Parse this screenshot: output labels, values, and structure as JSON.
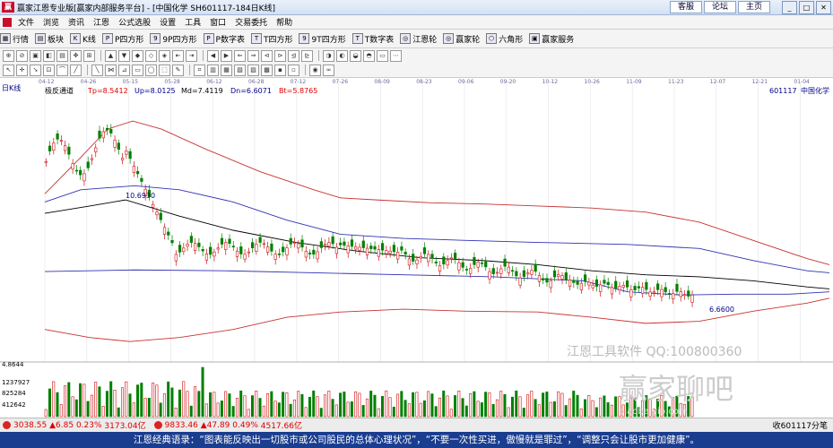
{
  "titlebar": {
    "title": "赢家江恩专业版[赢家内部服务平台] - [中国化学  SH601117-184日K线]",
    "links": [
      "客服",
      "论坛",
      "主页"
    ]
  },
  "menu": [
    "文件",
    "浏览",
    "资讯",
    "江恩",
    "公式选股",
    "设置",
    "工具",
    "窗口",
    "交易委托",
    "帮助"
  ],
  "toolbar": [
    "行情",
    "板块",
    "K线",
    "P四方形",
    "9P四方形",
    "P数字表",
    "T四方形",
    "9T四方形",
    "T数字表",
    "江恩轮",
    "赢家轮",
    "六角形",
    "赢家服务"
  ],
  "chart": {
    "period_label": "日K线",
    "indicator_name": "极反通道",
    "tp": "Tp=8.5412",
    "up": "Up=8.0125",
    "md": "Md=7.4119",
    "dn": "Dn=6.6071",
    "bt": "Bt=5.8765",
    "code": "601117",
    "name": "中国化学",
    "high_label": "10.6930",
    "low_label": "6.6600",
    "dates": [
      "04-12",
      "04-26",
      "05-15",
      "05-28",
      "06-12",
      "06-28",
      "07-12",
      "07-26",
      "08-09",
      "08-23",
      "09-06",
      "09-20",
      "10-12",
      "10-26",
      "11-09",
      "11-23",
      "12-07",
      "12-21",
      "01-04"
    ],
    "vol_labels": [
      "4.8644",
      "1237927",
      "825284",
      "412642"
    ],
    "watermark1": "江恩工具软件  QQ:100800360",
    "watermark2": "赢家聊吧",
    "watermark3": "piaoba.vip.com"
  },
  "chart_data": {
    "type": "candlestick",
    "period": "日K线",
    "high": 10.693,
    "low": 6.66,
    "tp": 8.5412,
    "up": 8.0125,
    "md": 7.4119,
    "dn": 6.6071,
    "bt": 5.8765,
    "x_labels": [
      "04-12",
      "04-26",
      "05-15",
      "05-28",
      "06-12",
      "06-28",
      "07-12",
      "07-26",
      "08-09",
      "08-23",
      "09-06",
      "09-20",
      "10-12",
      "10-26",
      "11-09",
      "11-23",
      "12-07",
      "12-21",
      "01-04"
    ],
    "volume_labels": [
      1237927,
      825284,
      412642
    ]
  },
  "statusbar": {
    "idx1_value": "3038.55",
    "idx1_change": "▲6.85",
    "idx1_pct": "0.23%",
    "idx1_amount": "3173.04亿",
    "idx2_value": "9833.46",
    "idx2_change": "▲47.89",
    "idx2_pct": "0.49%",
    "idx2_amount": "4517.66亿",
    "right_text": "收601117分笔"
  },
  "quote": "江恩经典语录：“图表能反映出一切股市或公司股民的总体心理状况”，“不要一次性买进，傲慢就是罪过”，“调整只会让股市更加健康”。"
}
